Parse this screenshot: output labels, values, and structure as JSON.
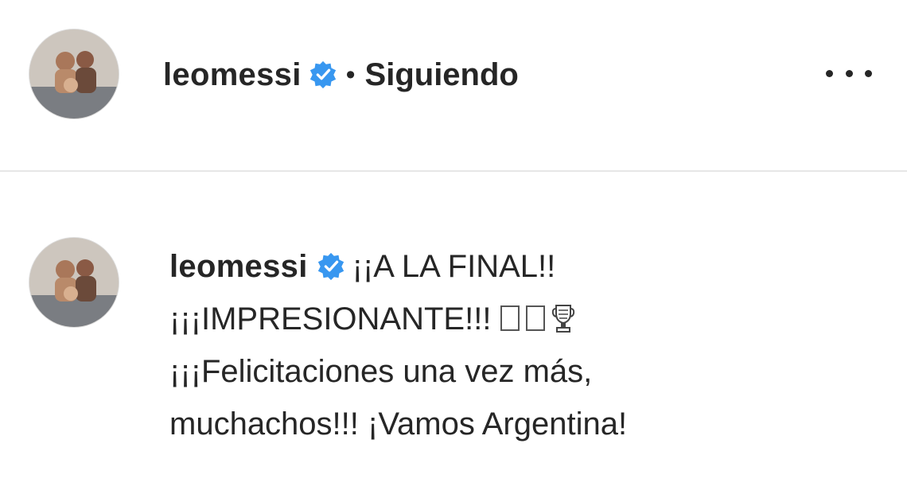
{
  "header": {
    "username": "leomessi",
    "separator": "•",
    "follow_status": "Siguiendo",
    "icons": {
      "verified": "verified-badge-icon",
      "more": "more-options-icon",
      "avatar": "profile-avatar"
    }
  },
  "caption": {
    "username": "leomessi",
    "lines": [
      "¡¡A LA FINAL!!",
      "¡¡¡IMPRESIONANTE!!!",
      "¡¡¡Felicitaciones una vez más,",
      "muchachos!!! ¡Vamos Argentina!"
    ],
    "emoji_icons": [
      "flag-emoji-box",
      "flag-emoji-box",
      "trophy-icon"
    ]
  },
  "colors": {
    "verified_blue": "#3897f0",
    "text": "#262626",
    "divider": "#e6e6e6"
  }
}
